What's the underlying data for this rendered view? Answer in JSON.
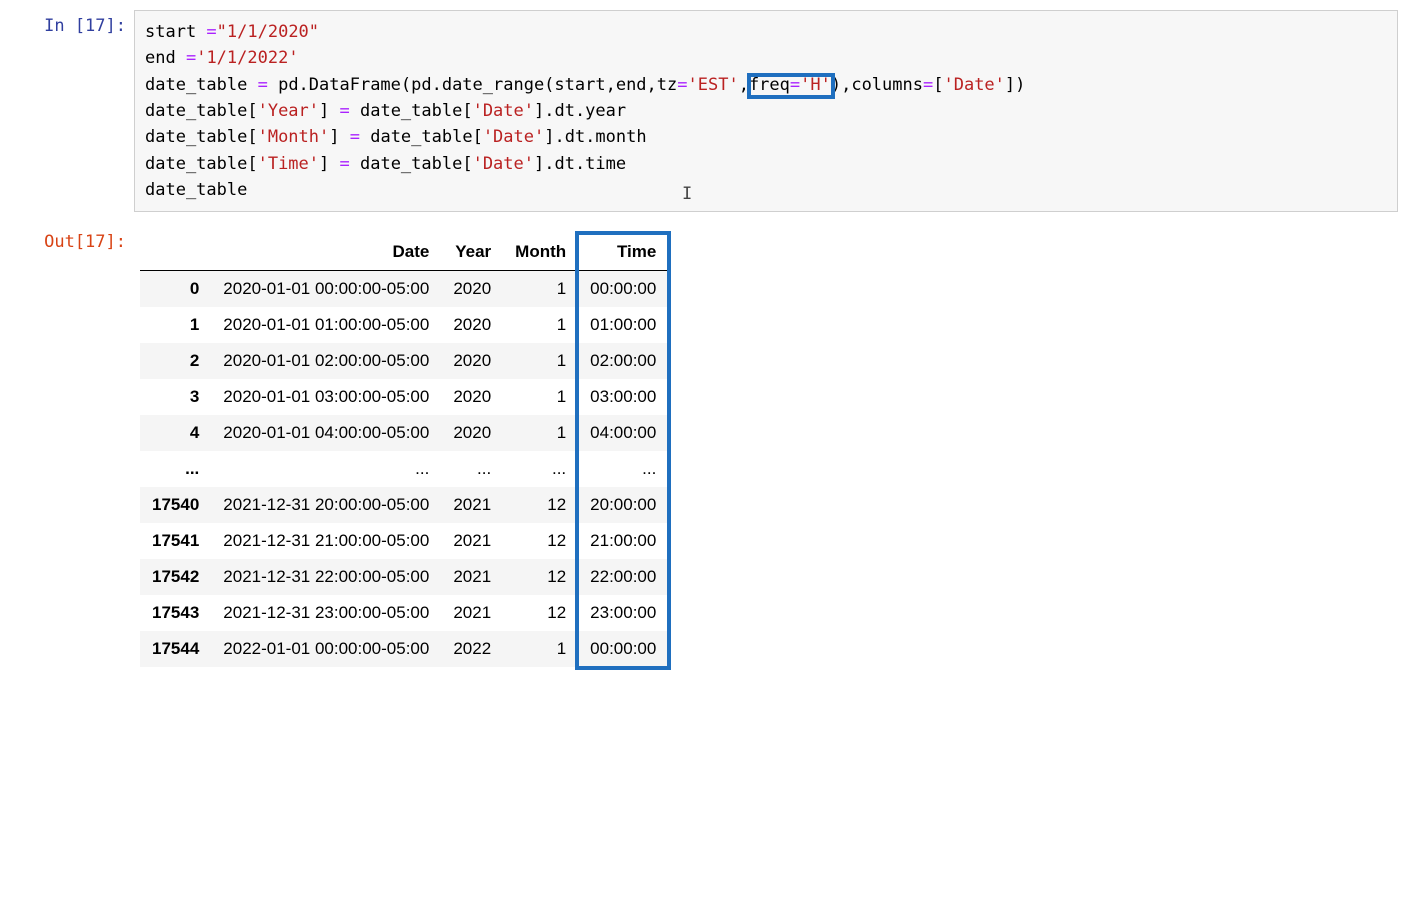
{
  "input": {
    "prompt": "In [17]:",
    "code": {
      "l1_a": "start ",
      "l1_eq": "=",
      "l1_b": "\"1/1/2020\"",
      "l2_a": "end ",
      "l2_eq": "=",
      "l2_b": "'1/1/2022'",
      "l3_a": "date_table ",
      "l3_eq": "=",
      "l3_b": " pd.DataFrame(pd.date_range(start,end,tz",
      "l3_eq2": "=",
      "l3_c": "'EST'",
      "l3_d": ",",
      "l3_freq_key": "freq",
      "l3_eq3": "=",
      "l3_e": "'H'",
      "l3_f": "),columns",
      "l3_eq4": "=",
      "l3_g": "[",
      "l3_h": "'Date'",
      "l3_i": "])",
      "l4_a": "date_table[",
      "l4_b": "'Year'",
      "l4_c": "] ",
      "l4_eq": "=",
      "l4_d": " date_table[",
      "l4_e": "'Date'",
      "l4_f": "].dt.year",
      "l5_a": "date_table[",
      "l5_b": "'Month'",
      "l5_c": "] ",
      "l5_eq": "=",
      "l5_d": " date_table[",
      "l5_e": "'Date'",
      "l5_f": "].dt.month",
      "l6_a": "date_table[",
      "l6_b": "'Time'",
      "l6_c": "] ",
      "l6_eq": "=",
      "l6_d": " date_table[",
      "l6_e": "'Date'",
      "l6_f": "].dt.time",
      "l7": "date_table"
    }
  },
  "output": {
    "prompt": "Out[17]:",
    "headers": {
      "index": "",
      "date": "Date",
      "year": "Year",
      "month": "Month",
      "time": "Time"
    },
    "rows": [
      {
        "idx": "0",
        "date": "2020-01-01 00:00:00-05:00",
        "year": "2020",
        "month": "1",
        "time": "00:00:00"
      },
      {
        "idx": "1",
        "date": "2020-01-01 01:00:00-05:00",
        "year": "2020",
        "month": "1",
        "time": "01:00:00"
      },
      {
        "idx": "2",
        "date": "2020-01-01 02:00:00-05:00",
        "year": "2020",
        "month": "1",
        "time": "02:00:00"
      },
      {
        "idx": "3",
        "date": "2020-01-01 03:00:00-05:00",
        "year": "2020",
        "month": "1",
        "time": "03:00:00"
      },
      {
        "idx": "4",
        "date": "2020-01-01 04:00:00-05:00",
        "year": "2020",
        "month": "1",
        "time": "04:00:00"
      },
      {
        "idx": "...",
        "date": "...",
        "year": "...",
        "month": "...",
        "time": "..."
      },
      {
        "idx": "17540",
        "date": "2021-12-31 20:00:00-05:00",
        "year": "2021",
        "month": "12",
        "time": "20:00:00"
      },
      {
        "idx": "17541",
        "date": "2021-12-31 21:00:00-05:00",
        "year": "2021",
        "month": "12",
        "time": "21:00:00"
      },
      {
        "idx": "17542",
        "date": "2021-12-31 22:00:00-05:00",
        "year": "2021",
        "month": "12",
        "time": "22:00:00"
      },
      {
        "idx": "17543",
        "date": "2021-12-31 23:00:00-05:00",
        "year": "2021",
        "month": "12",
        "time": "23:00:00"
      },
      {
        "idx": "17544",
        "date": "2022-01-01 00:00:00-05:00",
        "year": "2022",
        "month": "1",
        "time": "00:00:00"
      }
    ]
  },
  "annotations": {
    "code_highlight": "freq='H'",
    "column_highlight": "Time"
  }
}
